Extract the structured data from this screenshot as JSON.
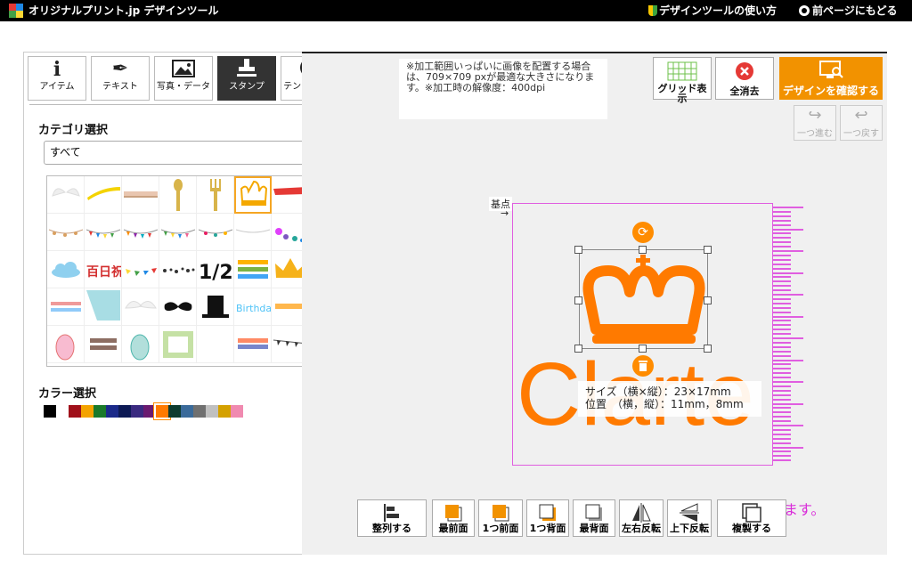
{
  "header": {
    "app_title": "オリジナルプリント.jp デザインツール",
    "help_link": "デザインツールの使い方",
    "back_link": "前ページにもどる"
  },
  "tabs": [
    {
      "label": "アイテム",
      "icon": "info-icon"
    },
    {
      "label": "テキスト",
      "icon": "pen-icon"
    },
    {
      "label": "写真・データ",
      "icon": "image-icon"
    },
    {
      "label": "スタンプ",
      "icon": "stamp-icon",
      "active": true
    },
    {
      "label": "テンプレート",
      "icon": "template-icon"
    }
  ],
  "category": {
    "title": "カテゴリ選択",
    "selected": "すべて"
  },
  "stamps": {
    "rows": [
      [
        "wings",
        "yellow swoosh",
        "lace ribbon",
        "spoon",
        "fork",
        "crown outline",
        "red banner"
      ],
      [
        "bunting",
        "flag garland",
        "flag garland",
        "bunting",
        "flower bunting",
        "flower dots"
      ],
      [
        "cloud",
        "百日祝",
        "triangle flags",
        "dots",
        "1/2",
        "HAPPY HALF BIRTHDAY",
        "gold crown"
      ],
      [
        "HALF BIRTHDAY",
        "1/2 block",
        "wings",
        "mustache",
        "top hat",
        "Birthday",
        "HALF BIRTHDAY"
      ],
      [
        "baby foot pink",
        "HALF BIRTHDAY",
        "baby foot",
        "green frame",
        "blank",
        "HALF BIRTHDAY",
        "flag line"
      ]
    ],
    "selected": "crown outline"
  },
  "color": {
    "title": "カラー選択",
    "swatches": [
      "#000000",
      "#ffffff",
      "#a0101a",
      "#f4a300",
      "#1a7a2a",
      "#1b2a8a",
      "#0d1a55",
      "#3a2a80",
      "#6a1a70",
      "#ff7a00",
      "#0e3b2e",
      "#3a6a9a",
      "#707070",
      "#c0c0c0",
      "#d4a100",
      "#f08ab0"
    ],
    "selected": "#ff7a00"
  },
  "notice": "※加工範囲いっぱいに画像を配置する場合は、709×709 pxが最適な大きさになります。※加工時の解像度：400dpi",
  "toolbar": {
    "grid_label": "グリッド表示",
    "clear_label": "全消去",
    "confirm_label": "デザインを確認する",
    "redo_label": "一つ進む",
    "undo_label": "一つ戻す"
  },
  "canvas": {
    "base_label": "基点",
    "base_arrow": "→",
    "design_text": "Clarte",
    "size_info": "サイズ（横×縦）：23×17mm",
    "position_info": "位置　（横，縦）：11mm，8mm",
    "bottom_hint": "ます。",
    "accent_color": "#ff7a00",
    "print_area_color": "#e05ee0"
  },
  "bottom_tools": [
    {
      "label": "整列する",
      "icon": "align-icon"
    },
    {
      "label": "最前面",
      "icon": "bring-front-icon"
    },
    {
      "label": "1つ前面",
      "icon": "bring-forward-icon"
    },
    {
      "label": "1つ背面",
      "icon": "send-backward-icon"
    },
    {
      "label": "最背面",
      "icon": "send-back-icon"
    },
    {
      "label": "左右反転",
      "icon": "flip-horizontal-icon"
    },
    {
      "label": "上下反転",
      "icon": "flip-vertical-icon"
    },
    {
      "label": "複製する",
      "icon": "duplicate-icon"
    }
  ]
}
